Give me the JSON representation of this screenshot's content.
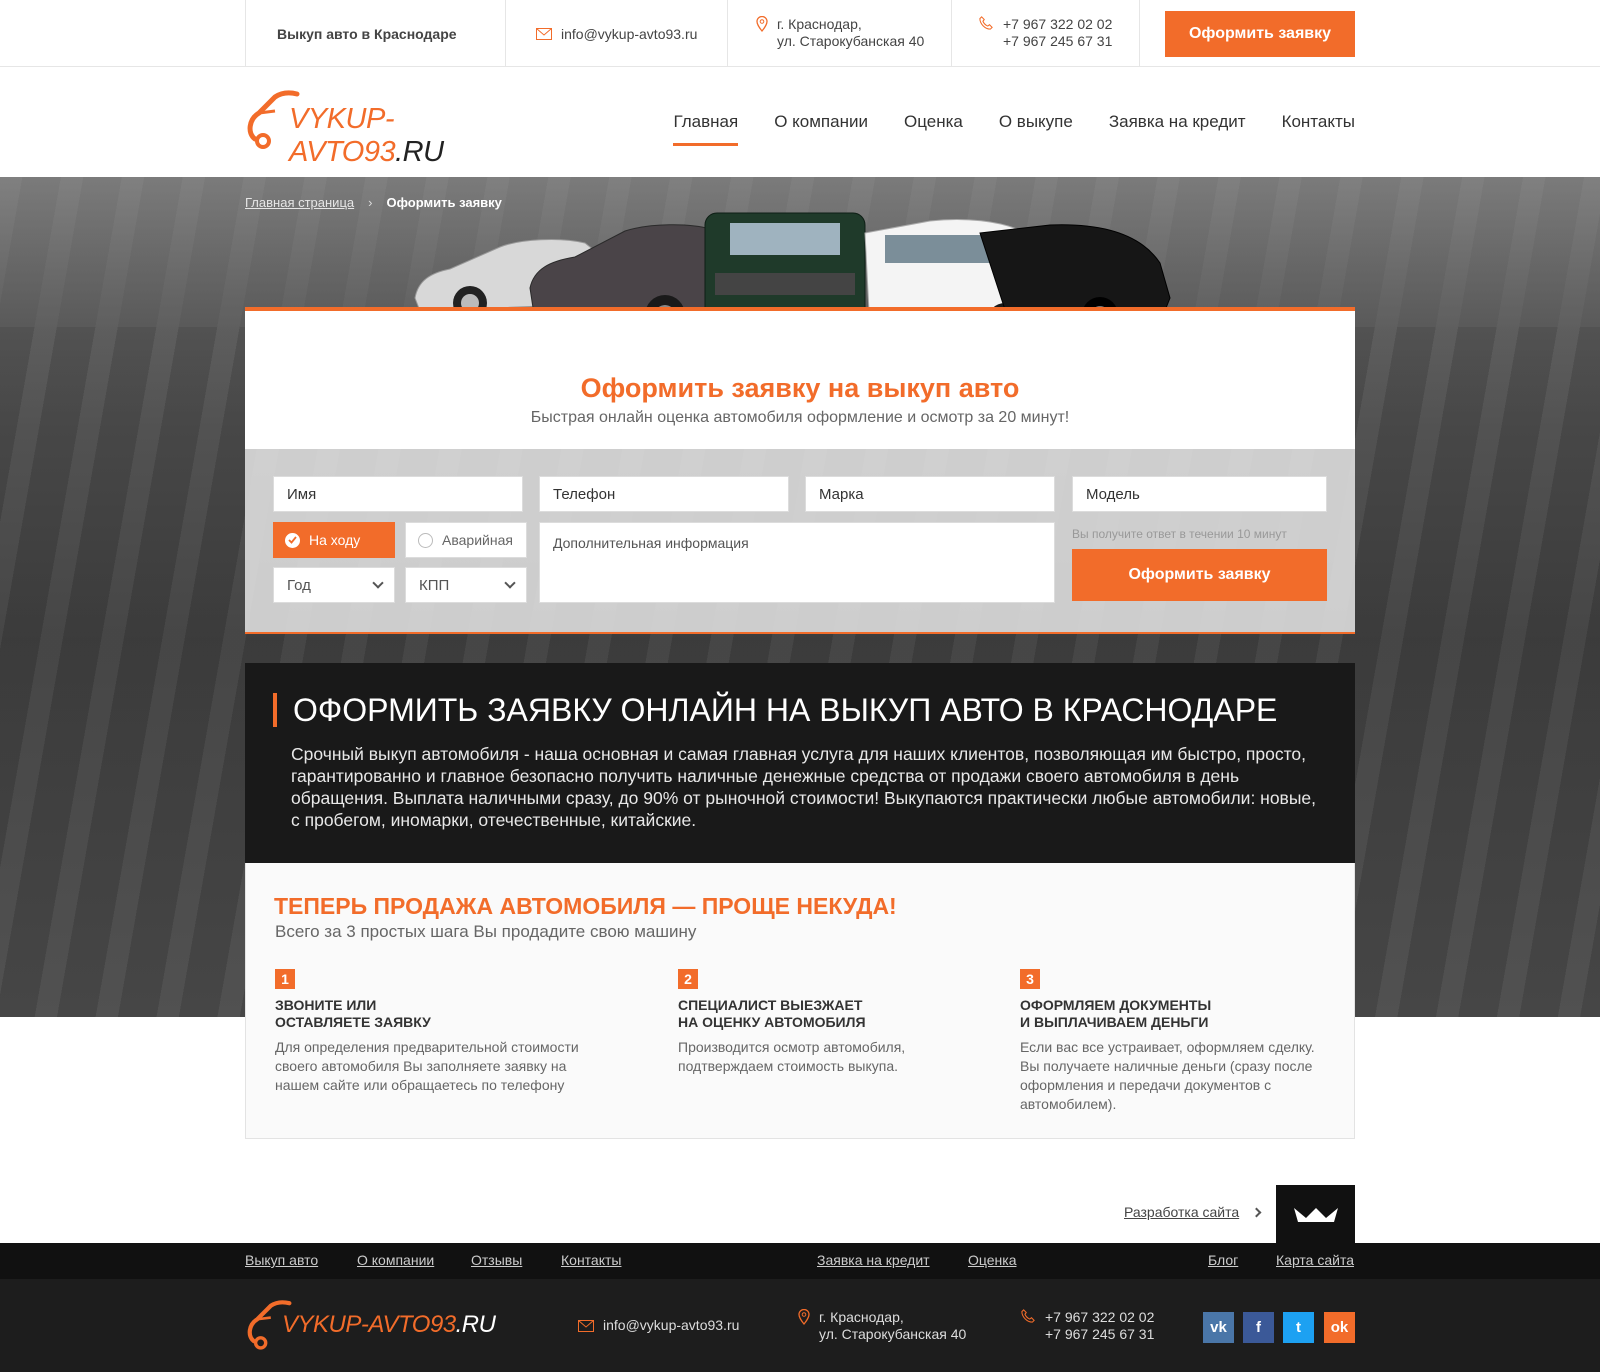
{
  "topbar": {
    "title": "Выкуп авто в Краснодаре",
    "email": "info@vykup-avto93.ru",
    "address_line1": "г. Краснодар,",
    "address_line2": "ул. Старокубанская 40",
    "phone1": "+7 967 322 02 02",
    "phone2": "+7 967 245 67 31",
    "cta_label": "Оформить заявку"
  },
  "header": {
    "logo_main": "VYKUP-AVTO93",
    "logo_domain": ".RU",
    "nav": [
      "Главная",
      "О компании",
      "Оценка",
      "О выкупе",
      "Заявка на кредит",
      "Контакты"
    ],
    "active_nav": "Главная"
  },
  "breadcrumb": {
    "home": "Главная страница",
    "current": "Оформить заявку"
  },
  "form": {
    "title": "Оформить заявку на выкуп авто",
    "subtitle": "Быстрая онлайн оценка автомобиля оформление и осмотр за 20 минут!",
    "name_placeholder": "Имя",
    "phone_placeholder": "Телефон",
    "brand_placeholder": "Марка",
    "model_placeholder": "Модель",
    "radio_running": "На ходу",
    "radio_damaged": "Аварийная",
    "year_select": "Год",
    "gearbox_select": "КПП",
    "extra_placeholder": "Дополнительная информация",
    "hint": "Вы получите ответ в течении 10 минут",
    "submit_label": "Оформить заявку"
  },
  "info": {
    "title": "ОФОРМИТЬ ЗАЯВКУ ОНЛАЙН НА ВЫКУП АВТО В КРАСНОДАРЕ",
    "text": "Срочный выкуп автомобиля - наша основная и самая главная услуга для наших клиентов, позволяющая им быстро, просто, гарантированно и главное безопасно получить наличные денежные средства от продажи своего автомобиля в день обращения. Выплата наличными сразу, до 90% от рыночной стоимости! Выкупаются практически любые автомобили: новые, с пробегом, иномарки, отечественные, китайские."
  },
  "steps": {
    "title": "ТЕПЕРЬ ПРОДАЖА АВТОМОБИЛЯ — ПРОЩЕ НЕКУДА!",
    "subtitle": "Всего за 3 простых шага Вы продадите свою машину",
    "items": [
      {
        "num": "1",
        "title1": "ЗВОНИТЕ ИЛИ",
        "title2": "ОСТАВЛЯЕТЕ ЗАЯВКУ",
        "text": "Для определения предварительной стоимости своего автомобиля Вы заполняете заявку на нашем сайте или обращаетесь по телефону"
      },
      {
        "num": "2",
        "title1": "СПЕЦИАЛИСТ ВЫЕЗЖАЕТ",
        "title2": "НА ОЦЕНКУ АВТОМОБИЛЯ",
        "text": "Производится осмотр автомобиля, подтверждаем стоимость выкупа."
      },
      {
        "num": "3",
        "title1": "ОФОРМЛЯЕМ ДОКУМЕНТЫ",
        "title2": "И ВЫПЛАЧИВАЕМ ДЕНЬГИ",
        "text": "Если вас все устраивает, оформляем сделку. Вы получаете наличные деньги (сразу после оформления и передачи документов с автомобилем)."
      }
    ]
  },
  "dev": {
    "label": "Разработка сайта"
  },
  "footer": {
    "nav_left": [
      "Выкуп авто",
      "О компании",
      "Отзывы",
      "Контакты"
    ],
    "nav_mid": [
      "Заявка на кредит",
      "Оценка"
    ],
    "nav_right": [
      "Блог",
      "Карта сайта"
    ],
    "email": "info@vykup-avto93.ru",
    "address_line1": "г. Краснодар,",
    "address_line2": "ул. Старокубанская 40",
    "phone1": "+7 967 322 02 02",
    "phone2": "+7 967 245 67 31",
    "social": [
      {
        "name": "vk-icon",
        "label": "vk",
        "color": "#4a76a8"
      },
      {
        "name": "facebook-icon",
        "label": "f",
        "color": "#3b5998"
      },
      {
        "name": "twitter-icon",
        "label": "t",
        "color": "#1da1f2"
      },
      {
        "name": "odnoklassniki-icon",
        "label": "ok",
        "color": "#f26c2a"
      }
    ]
  },
  "colors": {
    "accent": "#f26c2a",
    "dark": "#191919"
  }
}
